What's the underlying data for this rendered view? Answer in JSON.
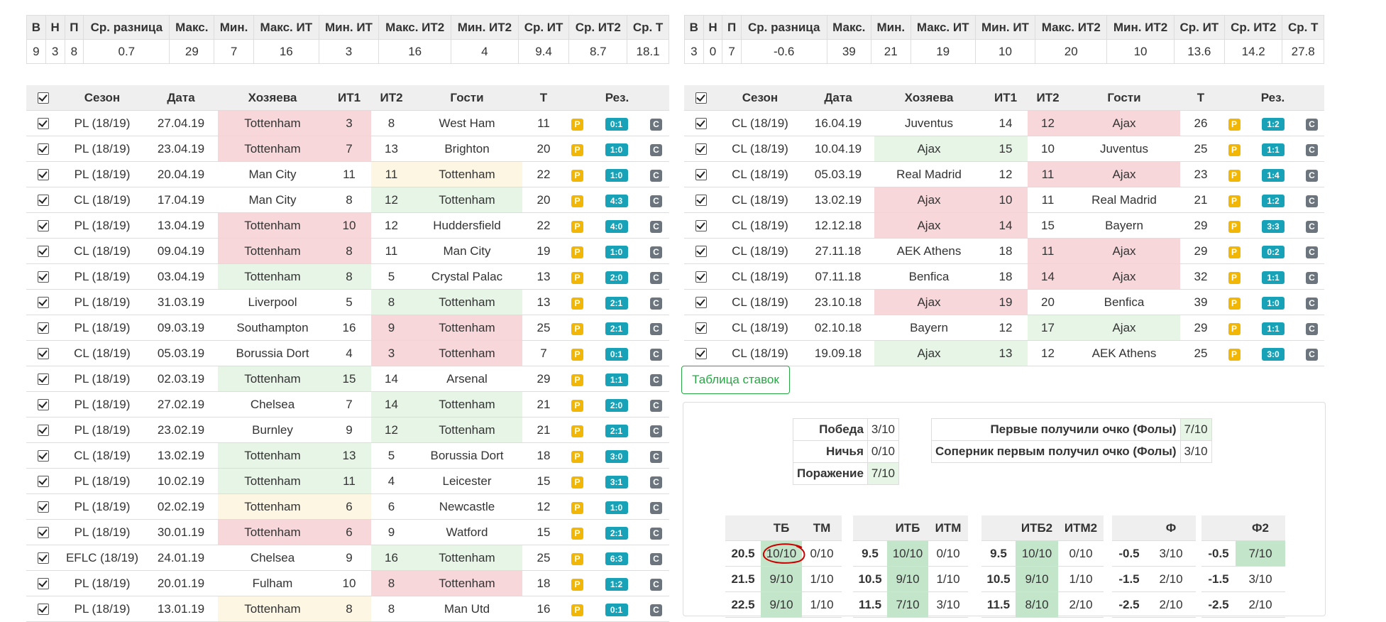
{
  "left_stats": {
    "headers": [
      "В",
      "Н",
      "П",
      "Ср. разница",
      "Макс.",
      "Мин.",
      "Макс. ИТ",
      "Мин. ИТ",
      "Макс. ИТ2",
      "Мин. ИТ2",
      "Ср. ИТ",
      "Ср. ИТ2",
      "Ср. Т"
    ],
    "values": [
      "9",
      "3",
      "8",
      "0.7",
      "29",
      "7",
      "16",
      "3",
      "16",
      "4",
      "9.4",
      "8.7",
      "18.1"
    ]
  },
  "right_stats": {
    "headers": [
      "В",
      "Н",
      "П",
      "Ср. разница",
      "Макс.",
      "Мин.",
      "Макс. ИТ",
      "Мин. ИТ",
      "Макс. ИТ2",
      "Мин. ИТ2",
      "Ср. ИТ",
      "Ср. ИТ2",
      "Ср. Т"
    ],
    "values": [
      "3",
      "0",
      "7",
      "-0.6",
      "39",
      "21",
      "19",
      "10",
      "20",
      "10",
      "13.6",
      "14.2",
      "27.8"
    ]
  },
  "match_headers": [
    "Сезон",
    "Дата",
    "Хозяева",
    "ИТ1",
    "ИТ2",
    "Гости",
    "Т",
    "Рез."
  ],
  "left_matches": [
    {
      "season": "PL (18/19)",
      "date": "27.04.19",
      "home": "Tottenham",
      "it1": "3",
      "it2": "8",
      "away": "West Ham",
      "t": "11",
      "score": "0:1",
      "hl": "home",
      "hc": "red"
    },
    {
      "season": "PL (18/19)",
      "date": "23.04.19",
      "home": "Tottenham",
      "it1": "7",
      "it2": "13",
      "away": "Brighton",
      "t": "20",
      "score": "1:0",
      "hl": "home",
      "hc": "red"
    },
    {
      "season": "PL (18/19)",
      "date": "20.04.19",
      "home": "Man City",
      "it1": "11",
      "it2": "11",
      "away": "Tottenham",
      "t": "22",
      "score": "1:0",
      "hl": "away",
      "hc": "yellow"
    },
    {
      "season": "CL (18/19)",
      "date": "17.04.19",
      "home": "Man City",
      "it1": "8",
      "it2": "12",
      "away": "Tottenham",
      "t": "20",
      "score": "4:3",
      "hl": "away",
      "hc": "green"
    },
    {
      "season": "PL (18/19)",
      "date": "13.04.19",
      "home": "Tottenham",
      "it1": "10",
      "it2": "12",
      "away": "Huddersfield",
      "t": "22",
      "score": "4:0",
      "hl": "home",
      "hc": "red"
    },
    {
      "season": "CL (18/19)",
      "date": "09.04.19",
      "home": "Tottenham",
      "it1": "8",
      "it2": "11",
      "away": "Man City",
      "t": "19",
      "score": "1:0",
      "hl": "home",
      "hc": "red"
    },
    {
      "season": "PL (18/19)",
      "date": "03.04.19",
      "home": "Tottenham",
      "it1": "8",
      "it2": "5",
      "away": "Crystal Palac",
      "t": "13",
      "score": "2:0",
      "hl": "home",
      "hc": "green"
    },
    {
      "season": "PL (18/19)",
      "date": "31.03.19",
      "home": "Liverpool",
      "it1": "5",
      "it2": "8",
      "away": "Tottenham",
      "t": "13",
      "score": "2:1",
      "hl": "away",
      "hc": "green"
    },
    {
      "season": "PL (18/19)",
      "date": "09.03.19",
      "home": "Southampton",
      "it1": "16",
      "it2": "9",
      "away": "Tottenham",
      "t": "25",
      "score": "2:1",
      "hl": "away",
      "hc": "red"
    },
    {
      "season": "CL (18/19)",
      "date": "05.03.19",
      "home": "Borussia Dort",
      "it1": "4",
      "it2": "3",
      "away": "Tottenham",
      "t": "7",
      "score": "0:1",
      "hl": "away",
      "hc": "red"
    },
    {
      "season": "PL (18/19)",
      "date": "02.03.19",
      "home": "Tottenham",
      "it1": "15",
      "it2": "14",
      "away": "Arsenal",
      "t": "29",
      "score": "1:1",
      "hl": "home",
      "hc": "green"
    },
    {
      "season": "PL (18/19)",
      "date": "27.02.19",
      "home": "Chelsea",
      "it1": "7",
      "it2": "14",
      "away": "Tottenham",
      "t": "21",
      "score": "2:0",
      "hl": "away",
      "hc": "green"
    },
    {
      "season": "PL (18/19)",
      "date": "23.02.19",
      "home": "Burnley",
      "it1": "9",
      "it2": "12",
      "away": "Tottenham",
      "t": "21",
      "score": "2:1",
      "hl": "away",
      "hc": "green"
    },
    {
      "season": "CL (18/19)",
      "date": "13.02.19",
      "home": "Tottenham",
      "it1": "13",
      "it2": "5",
      "away": "Borussia Dort",
      "t": "18",
      "score": "3:0",
      "hl": "home",
      "hc": "green"
    },
    {
      "season": "PL (18/19)",
      "date": "10.02.19",
      "home": "Tottenham",
      "it1": "11",
      "it2": "4",
      "away": "Leicester",
      "t": "15",
      "score": "3:1",
      "hl": "home",
      "hc": "green"
    },
    {
      "season": "PL (18/19)",
      "date": "02.02.19",
      "home": "Tottenham",
      "it1": "6",
      "it2": "6",
      "away": "Newcastle",
      "t": "12",
      "score": "1:0",
      "hl": "home",
      "hc": "yellow"
    },
    {
      "season": "PL (18/19)",
      "date": "30.01.19",
      "home": "Tottenham",
      "it1": "6",
      "it2": "9",
      "away": "Watford",
      "t": "15",
      "score": "2:1",
      "hl": "home",
      "hc": "red"
    },
    {
      "season": "EFLC (18/19)",
      "date": "24.01.19",
      "home": "Chelsea",
      "it1": "9",
      "it2": "16",
      "away": "Tottenham",
      "t": "25",
      "score": "6:3",
      "hl": "away",
      "hc": "green"
    },
    {
      "season": "PL (18/19)",
      "date": "20.01.19",
      "home": "Fulham",
      "it1": "10",
      "it2": "8",
      "away": "Tottenham",
      "t": "18",
      "score": "1:2",
      "hl": "away",
      "hc": "red"
    },
    {
      "season": "PL (18/19)",
      "date": "13.01.19",
      "home": "Tottenham",
      "it1": "8",
      "it2": "8",
      "away": "Man Utd",
      "t": "16",
      "score": "0:1",
      "hl": "home",
      "hc": "yellow"
    }
  ],
  "right_matches": [
    {
      "season": "CL (18/19)",
      "date": "16.04.19",
      "home": "Juventus",
      "it1": "14",
      "it2": "12",
      "away": "Ajax",
      "t": "26",
      "score": "1:2",
      "hl": "away",
      "hc": "red"
    },
    {
      "season": "CL (18/19)",
      "date": "10.04.19",
      "home": "Ajax",
      "it1": "15",
      "it2": "10",
      "away": "Juventus",
      "t": "25",
      "score": "1:1",
      "hl": "home",
      "hc": "green"
    },
    {
      "season": "CL (18/19)",
      "date": "05.03.19",
      "home": "Real Madrid",
      "it1": "12",
      "it2": "11",
      "away": "Ajax",
      "t": "23",
      "score": "1:4",
      "hl": "away",
      "hc": "red"
    },
    {
      "season": "CL (18/19)",
      "date": "13.02.19",
      "home": "Ajax",
      "it1": "10",
      "it2": "11",
      "away": "Real Madrid",
      "t": "21",
      "score": "1:2",
      "hl": "home",
      "hc": "red"
    },
    {
      "season": "CL (18/19)",
      "date": "12.12.18",
      "home": "Ajax",
      "it1": "14",
      "it2": "15",
      "away": "Bayern",
      "t": "29",
      "score": "3:3",
      "hl": "home",
      "hc": "red"
    },
    {
      "season": "CL (18/19)",
      "date": "27.11.18",
      "home": "AEK Athens",
      "it1": "18",
      "it2": "11",
      "away": "Ajax",
      "t": "29",
      "score": "0:2",
      "hl": "away",
      "hc": "red"
    },
    {
      "season": "CL (18/19)",
      "date": "07.11.18",
      "home": "Benfica",
      "it1": "18",
      "it2": "14",
      "away": "Ajax",
      "t": "32",
      "score": "1:1",
      "hl": "away",
      "hc": "red"
    },
    {
      "season": "CL (18/19)",
      "date": "23.10.18",
      "home": "Ajax",
      "it1": "19",
      "it2": "20",
      "away": "Benfica",
      "t": "39",
      "score": "1:0",
      "hl": "home",
      "hc": "red"
    },
    {
      "season": "CL (18/19)",
      "date": "02.10.18",
      "home": "Bayern",
      "it1": "12",
      "it2": "17",
      "away": "Ajax",
      "t": "29",
      "score": "1:1",
      "hl": "away",
      "hc": "green"
    },
    {
      "season": "CL (18/19)",
      "date": "19.09.18",
      "home": "Ajax",
      "it1": "13",
      "it2": "12",
      "away": "AEK Athens",
      "t": "25",
      "score": "3:0",
      "hl": "home",
      "hc": "green"
    }
  ],
  "badges": {
    "p": "P",
    "c": "C"
  },
  "bets_button": "Таблица ставок",
  "outcomes": [
    {
      "label": "Победа",
      "value": "3/10"
    },
    {
      "label": "Ничья",
      "value": "0/10"
    },
    {
      "label": "Поражение",
      "value": "7/10"
    }
  ],
  "first_point": [
    {
      "label": "Первые получили очко (Фолы)",
      "value": "7/10"
    },
    {
      "label": "Соперник первым получил очко (Фолы)",
      "value": "3/10"
    }
  ],
  "bet_tables": [
    {
      "headers": [
        "",
        "ТБ",
        "ТМ"
      ],
      "rows": [
        [
          "20.5",
          "10/10",
          "0/10"
        ],
        [
          "21.5",
          "9/10",
          "1/10"
        ],
        [
          "22.5",
          "9/10",
          "1/10"
        ]
      ]
    },
    {
      "headers": [
        "",
        "ИТБ",
        "ИТМ"
      ],
      "rows": [
        [
          "9.5",
          "10/10",
          "0/10"
        ],
        [
          "10.5",
          "9/10",
          "1/10"
        ],
        [
          "11.5",
          "7/10",
          "3/10"
        ]
      ]
    },
    {
      "headers": [
        "",
        "ИТБ2",
        "ИТМ2"
      ],
      "rows": [
        [
          "9.5",
          "10/10",
          "0/10"
        ],
        [
          "10.5",
          "9/10",
          "1/10"
        ],
        [
          "11.5",
          "8/10",
          "2/10"
        ]
      ]
    },
    {
      "headers": [
        "",
        "Ф"
      ],
      "rows": [
        [
          "-0.5",
          "3/10"
        ],
        [
          "-1.5",
          "2/10"
        ],
        [
          "-2.5",
          "2/10"
        ]
      ]
    },
    {
      "headers": [
        "",
        "Ф2"
      ],
      "rows": [
        [
          "-0.5",
          "7/10"
        ],
        [
          "-1.5",
          "3/10"
        ],
        [
          "-2.5",
          "2/10"
        ]
      ]
    }
  ],
  "colors": {
    "red": "#f8d7da",
    "green": "#e6f5e6",
    "yellow": "#fdf6e3",
    "highlight": "#c3e6cb",
    "badge_p": "#f2b705",
    "badge_score": "#17a2b8",
    "badge_c": "#6c757d",
    "button": "#28a745",
    "annotation": "#cc0000"
  }
}
